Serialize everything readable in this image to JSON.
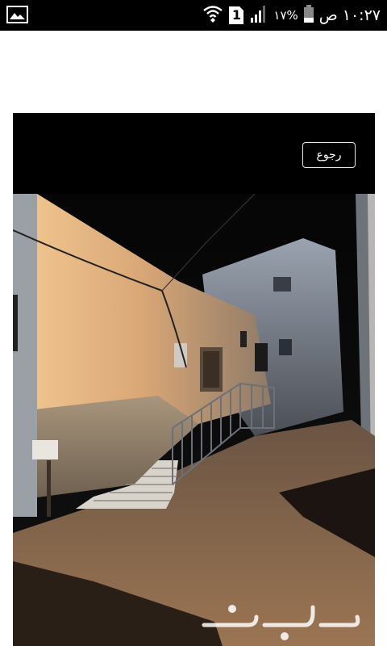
{
  "status_bar": {
    "time": "١٠:٢٧",
    "am_pm": "ص",
    "battery_percent": "١٧%",
    "sim_slot": "1",
    "icons": [
      "gallery-icon",
      "wifi-icon",
      "sim-icon",
      "signal-icon",
      "battery-icon"
    ]
  },
  "viewer": {
    "back_label": "رجوع",
    "watermark": "حراج",
    "photo_description_icon": "street-night-photo"
  },
  "colors": {
    "status_bar_bg": "#000000",
    "page_bg": "#ffffff",
    "viewer_bg": "#000000",
    "wall_lit": "#e6b880",
    "wall_dark": "#6b5a4a",
    "road": "#8a6a4a"
  }
}
